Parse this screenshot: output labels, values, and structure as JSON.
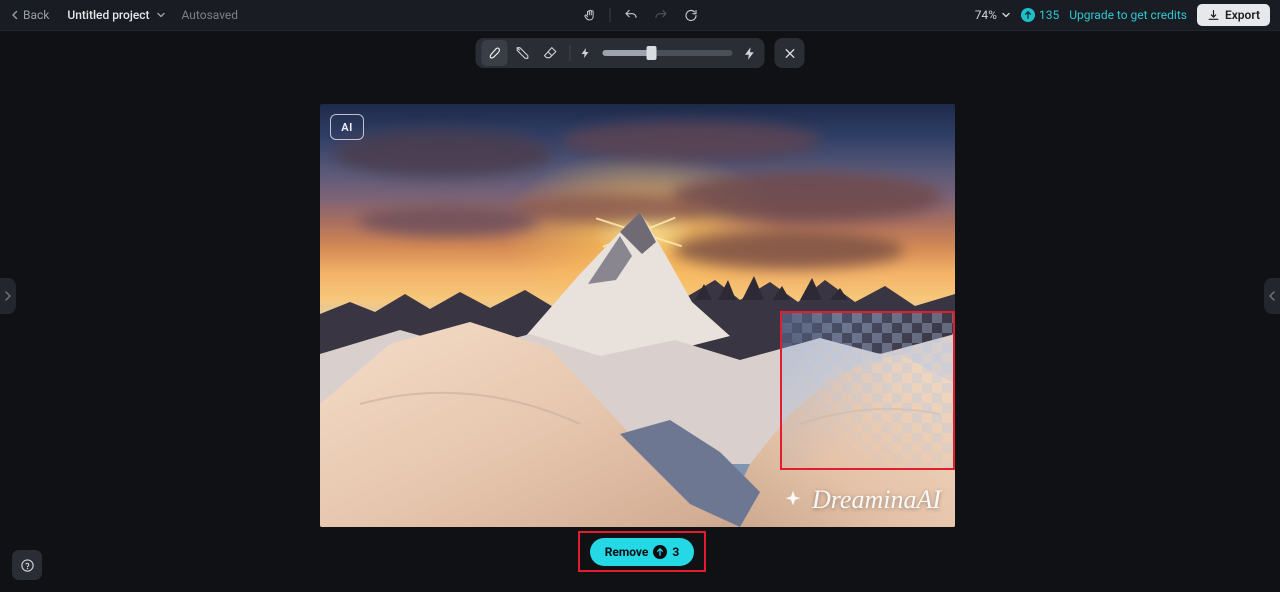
{
  "header": {
    "back_label": "Back",
    "project_name": "Untitled project",
    "saved_status": "Autosaved",
    "zoom_text": "74%",
    "credits_count": "135",
    "upgrade_text": "Upgrade to get credits",
    "export_label": "Export"
  },
  "toolbar": {
    "brush_tool": "brush",
    "lasso_tool": "lasso",
    "eraser_tool": "eraser",
    "slider_left_icon": "brush-size-small",
    "slider_right_icon": "brush-size-large",
    "slider_value_pct": 38,
    "close_label": "close"
  },
  "canvas": {
    "ai_badge": "AI",
    "watermark_text": "DreaminaAI"
  },
  "action": {
    "remove_label": "Remove",
    "remove_cost": "3"
  },
  "icons": {
    "hand": "hand-icon",
    "undo": "undo-icon",
    "redo": "redo-icon",
    "refresh": "refresh-icon"
  }
}
